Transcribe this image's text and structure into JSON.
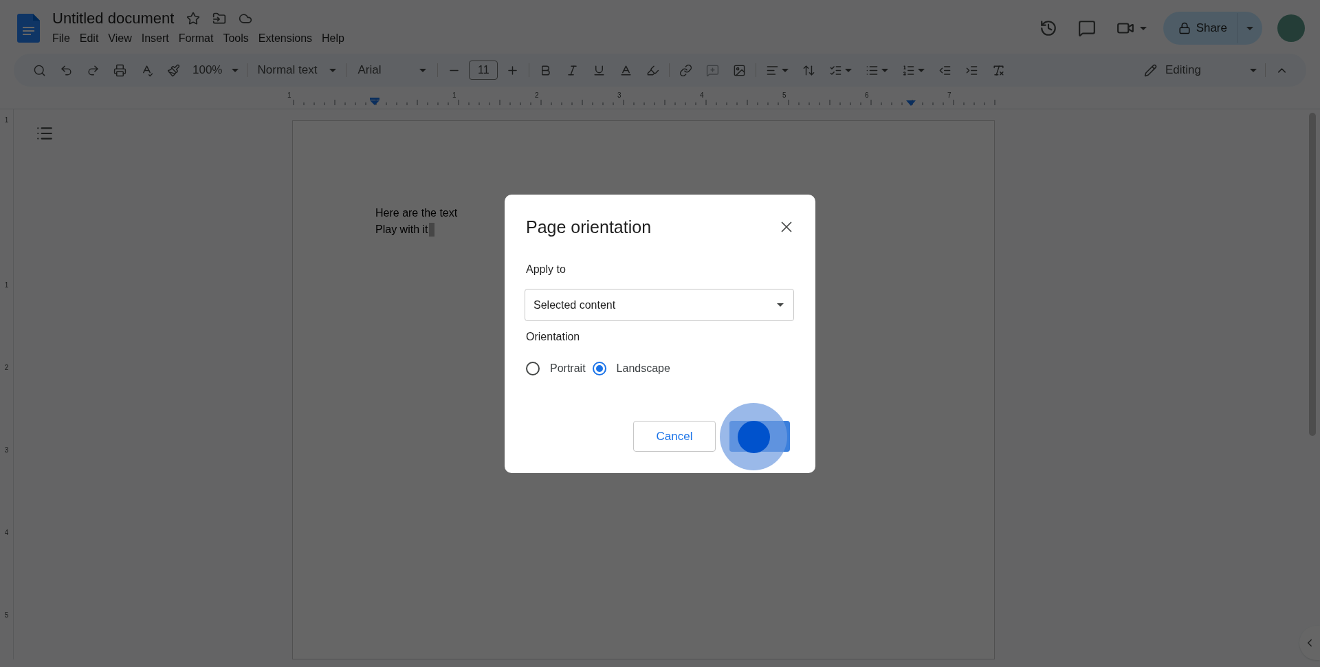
{
  "document_title": "Untitled document",
  "menu": [
    "File",
    "Edit",
    "View",
    "Insert",
    "Format",
    "Tools",
    "Extensions",
    "Help"
  ],
  "share": {
    "label": "Share"
  },
  "toolbar": {
    "zoom": "100%",
    "style": "Normal text",
    "font": "Arial",
    "font_size": "11",
    "mode": "Editing"
  },
  "ruler": {
    "horizontal": [
      "1",
      "1",
      "2",
      "3",
      "4",
      "5",
      "6",
      "7"
    ],
    "vertical": [
      "1",
      "1",
      "2",
      "3",
      "4",
      "5"
    ]
  },
  "document": {
    "lines": [
      "Here are the text",
      "Play with it"
    ]
  },
  "dialog": {
    "title": "Page orientation",
    "apply_to_label": "Apply to",
    "apply_to_value": "Selected content",
    "orientation_label": "Orientation",
    "options": [
      {
        "label": "Portrait",
        "selected": false
      },
      {
        "label": "Landscape",
        "selected": true
      }
    ],
    "cancel": "Cancel"
  }
}
